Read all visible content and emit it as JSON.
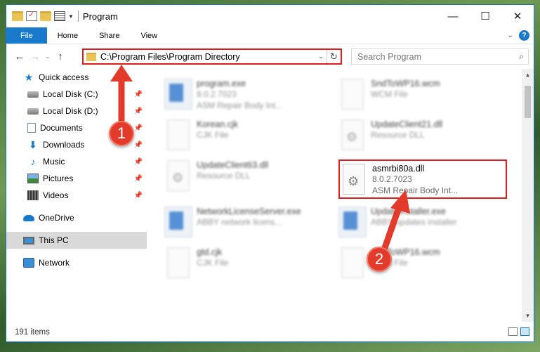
{
  "window": {
    "title": "Program",
    "controls": {
      "minimize": "—",
      "maximize": "☐",
      "close": "✕"
    }
  },
  "ribbon": {
    "tabs": [
      {
        "label": "File"
      },
      {
        "label": "Home"
      },
      {
        "label": "Share"
      },
      {
        "label": "View"
      }
    ],
    "help": "?"
  },
  "navigation": {
    "address": "C:\\Program Files\\Program Directory",
    "search_placeholder": "Search Program"
  },
  "sidebar": {
    "items": [
      {
        "label": "Quick access"
      },
      {
        "label": "Local Disk (C:)"
      },
      {
        "label": "Local Disk (D:)"
      },
      {
        "label": "Documents"
      },
      {
        "label": "Downloads"
      },
      {
        "label": "Music"
      },
      {
        "label": "Pictures"
      },
      {
        "label": "Videos"
      },
      {
        "label": "OneDrive"
      },
      {
        "label": "This PC"
      },
      {
        "label": "Network"
      }
    ]
  },
  "files": [
    {
      "name": "program.exe",
      "line2": "8.0.2.7023",
      "line3": "ASM Repair Body Int..."
    },
    {
      "name": "SndToWP16.wcm",
      "line2": "WCM File",
      "line3": ""
    },
    {
      "name": "Korean.cjk",
      "line2": "CJK File",
      "line3": ""
    },
    {
      "name": "UpdateClient21.dll",
      "line2": "Resource DLL",
      "line3": ""
    },
    {
      "name": "UpdateClient63.dll",
      "line2": "Resource DLL",
      "line3": ""
    },
    {
      "name": "asmrbi80a.dll",
      "line2": "8.0.2.7023",
      "line3": "ASM Repair Body Int..."
    },
    {
      "name": "NetworkLicenseServer.exe",
      "line2": "ABBY network licens...",
      "line3": ""
    },
    {
      "name": "UpdateInstaller.exe",
      "line2": "ABBY updates installer",
      "line3": ""
    },
    {
      "name": "gtd.cjk",
      "line2": "CJK File",
      "line3": ""
    },
    {
      "name": "SndToWP16.wcm",
      "line2": "WCM File",
      "line3": ""
    }
  ],
  "status": {
    "item_count": "191 items"
  },
  "annotations": {
    "step1": "1",
    "step2": "2",
    "color": "#e31b1b"
  }
}
